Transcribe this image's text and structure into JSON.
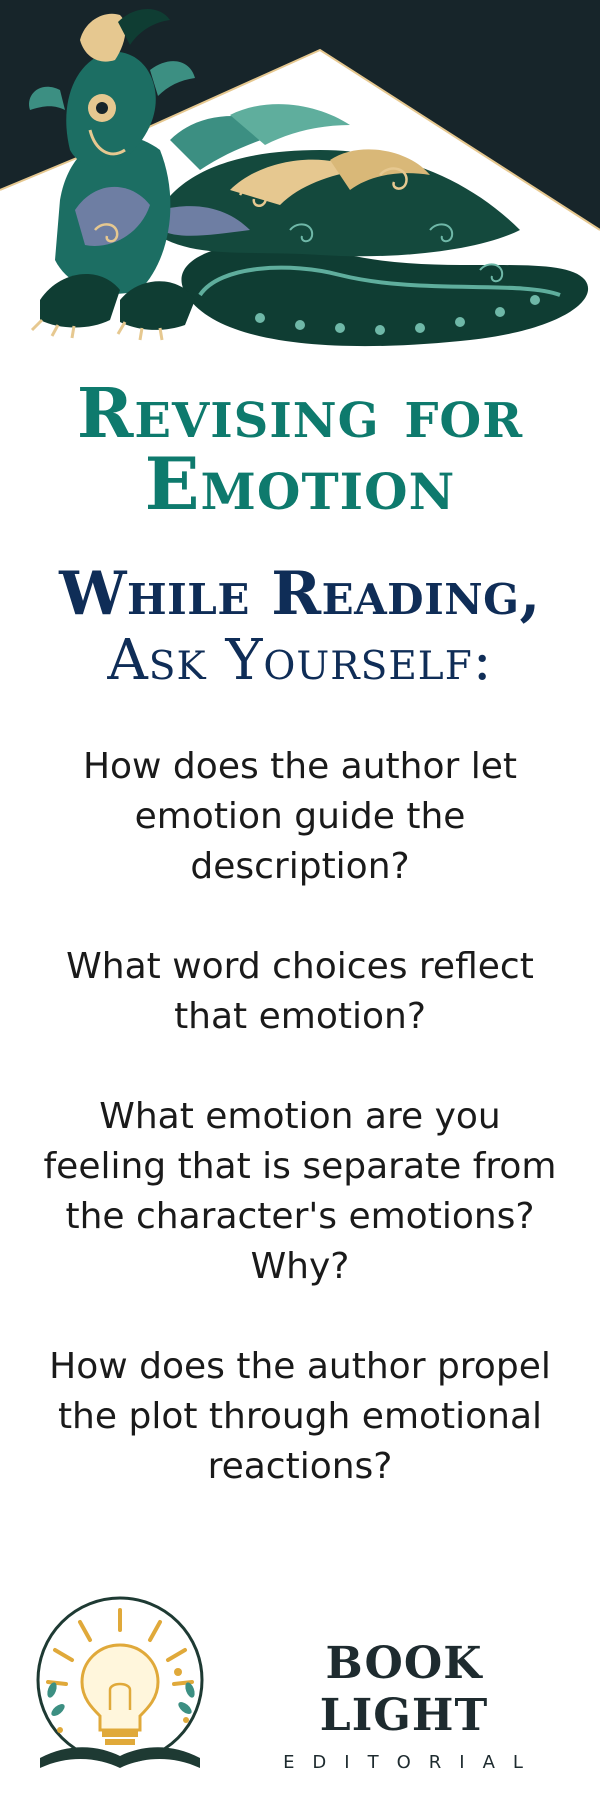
{
  "hero": {
    "illustration": "dragon-illustration",
    "colors": {
      "night": "#17252a",
      "teal": "#1c6e63",
      "deep": "#0f3d33",
      "gold": "#e6c890",
      "slate": "#6e7ea3"
    }
  },
  "title": {
    "line1": "Revising for",
    "line2": "Emotion"
  },
  "subhead": {
    "line1": "While Reading,",
    "line2": "Ask Yourself:"
  },
  "questions": [
    "How does the author let emotion guide the description?",
    "What word choices reflect that emotion?",
    "What emotion are you feeling that is separate from the character's emotions? Why?",
    "How does the author propel the plot through emotional reactions?"
  ],
  "brand": {
    "name": "BOOK LIGHT",
    "tagline": "EDITORIAL",
    "logo_icon": "lightbulb-book-icon"
  },
  "colors": {
    "title": "#0e7a6d",
    "subhead": "#0f2d57",
    "body": "#1a1a1a",
    "brand": "#1e2b2f",
    "gold": "#e0a93a"
  }
}
